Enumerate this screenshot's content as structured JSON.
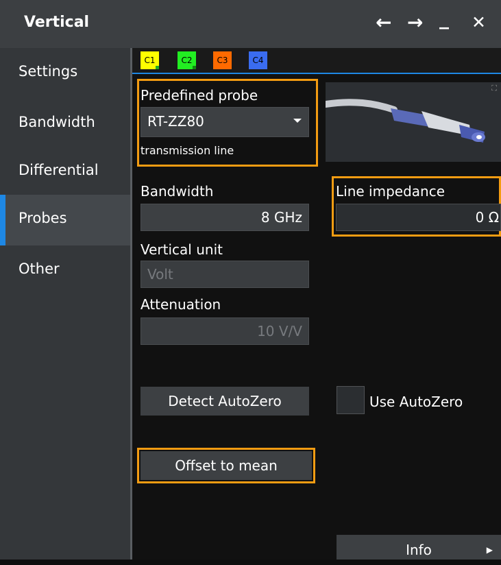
{
  "window": {
    "title": "Vertical",
    "back_glyph": "←",
    "forward_glyph": "→",
    "minimize_glyph": "_",
    "close_glyph": "✕"
  },
  "sidebar": {
    "items": [
      {
        "label": "Settings"
      },
      {
        "label": "Bandwidth"
      },
      {
        "label": "Differential"
      },
      {
        "label": "Probes",
        "active": true
      },
      {
        "label": "Other"
      }
    ]
  },
  "tabs": [
    {
      "label": "C1",
      "color": "#ffff00"
    },
    {
      "label": "C2",
      "color": "#22ee22"
    },
    {
      "label": "C3",
      "color": "#ff6a00"
    },
    {
      "label": "C4",
      "color": "#3a6cf0"
    }
  ],
  "probe": {
    "predefined_label": "Predefined probe",
    "selected": "RT-ZZ80",
    "description": "transmission line"
  },
  "bandwidth": {
    "label": "Bandwidth",
    "value": "8 GHz"
  },
  "line_impedance": {
    "label": "Line impedance",
    "value": "0 Ω"
  },
  "vertical_unit": {
    "label": "Vertical unit",
    "value": "Volt"
  },
  "attenuation": {
    "label": "Attenuation",
    "value": "10 V/V"
  },
  "buttons": {
    "detect_autozero": "Detect AutoZero",
    "use_autozero": "Use AutoZero",
    "offset_to_mean": "Offset to mean",
    "info": "Info"
  },
  "colors": {
    "highlight": "#f39c12",
    "accent": "#1e88e5"
  }
}
